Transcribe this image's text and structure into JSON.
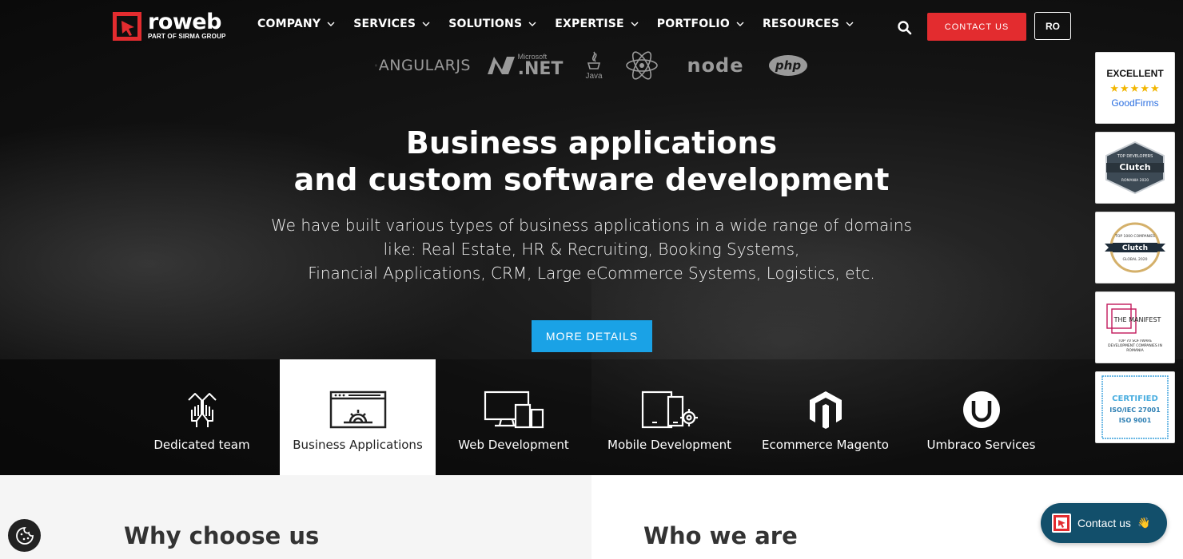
{
  "header": {
    "logo": {
      "name": "roweb",
      "sub": "PART OF SIRMA GROUP"
    },
    "nav": [
      {
        "label": "COMPANY"
      },
      {
        "label": "SERVICES"
      },
      {
        "label": "SOLUTIONS"
      },
      {
        "label": "EXPERTISE"
      },
      {
        "label": "PORTFOLIO"
      },
      {
        "label": "RESOURCES"
      }
    ],
    "contact_label": "CONTACT US",
    "lang_label": "RO"
  },
  "tech_logos": {
    "angular": "ANGULARJS",
    "net": ".NET",
    "net_brand": "Microsoft",
    "java": "Java",
    "react": "react-icon",
    "node": "node",
    "php": "php"
  },
  "hero": {
    "title_line1": "Business applications",
    "title_line2": "and custom software development",
    "desc_line1": "We have built various types of business applications in a wide range of domains",
    "desc_line2": "like: Real Estate, HR & Recruiting, Booking Systems,",
    "desc_line3": "Financial Applications, CRM, Large eCommerce Systems, Logistics, etc.",
    "cta_label": "MORE DETAILS"
  },
  "tabs": [
    {
      "label": "Dedicated team",
      "icon": "team-hands-icon"
    },
    {
      "label": "Business Applications",
      "icon": "browser-gear-icon",
      "active": true
    },
    {
      "label": "Web Development",
      "icon": "devices-icon"
    },
    {
      "label": "Mobile Development",
      "icon": "mobile-gear-icon"
    },
    {
      "label": "Ecommerce Magento",
      "icon": "magento-icon"
    },
    {
      "label": "Umbraco Services",
      "icon": "umbraco-icon"
    }
  ],
  "badges": {
    "goodfirms": {
      "title": "EXCELLENT",
      "stars": "★★★★★",
      "brand": "GoodFirms"
    },
    "clutch1": {
      "top": "TOP DEVELOPERS",
      "brand": "Clutch",
      "bottom": "ROMANIA 2020"
    },
    "clutch2": {
      "top": "TOP 1000 COMPANIES",
      "brand": "Clutch",
      "bottom": "GLOBAL 2020"
    },
    "manifest": {
      "brand": "THE MANIFEST",
      "sub": "TOP 70 SOFTWARE DEVELOPMENT COMPANIES IN ROMANIA"
    },
    "iso": {
      "line1": "CERTIFIED",
      "line2": "ISO/IEC 27001",
      "line3": "ISO 9001"
    }
  },
  "lower": {
    "why_title": "Why choose us",
    "who_title": "Who we are"
  },
  "chat": {
    "label": "Contact us",
    "emoji": "👋"
  }
}
